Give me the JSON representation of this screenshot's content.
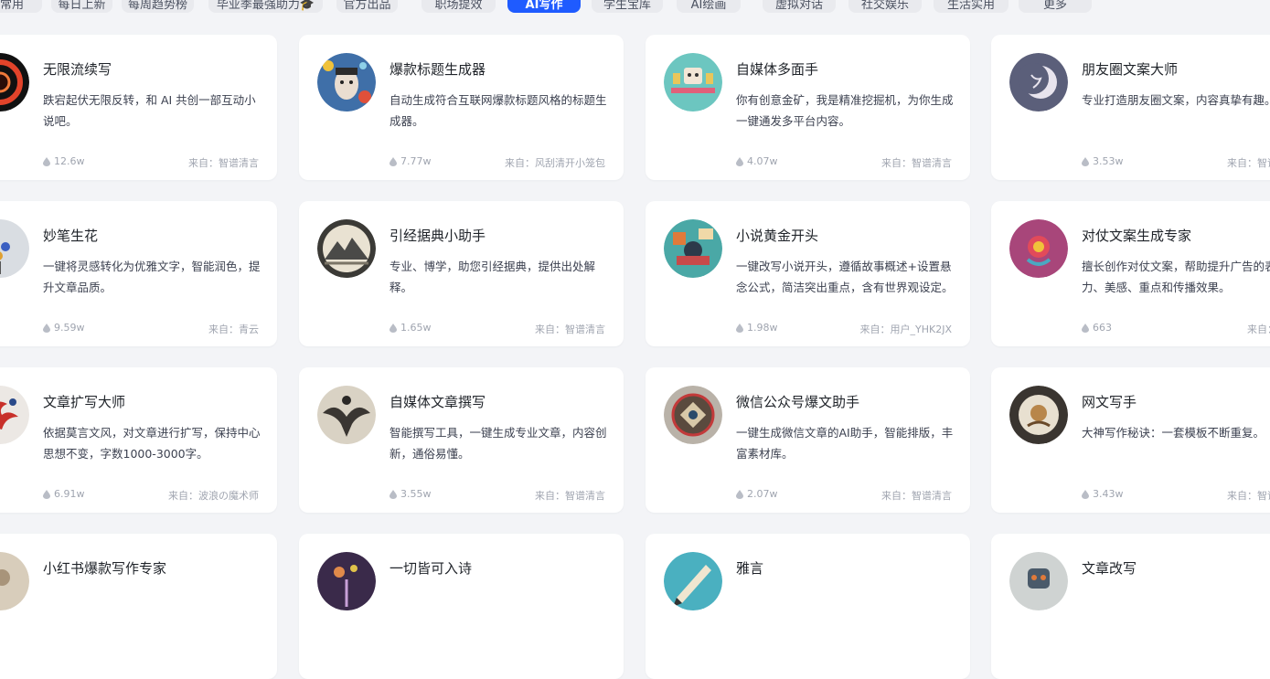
{
  "tabs": [
    {
      "label": "常用"
    },
    {
      "label": "每日上新"
    },
    {
      "label": "每周趋势榜"
    },
    {
      "label": "毕业季最强助力🎓"
    },
    {
      "label": "官方出品"
    },
    {
      "label": "职场提效"
    },
    {
      "label": "AI写作"
    },
    {
      "label": "学生宝库"
    },
    {
      "label": "AI绘画"
    },
    {
      "label": "虚拟对话"
    },
    {
      "label": "社交娱乐"
    },
    {
      "label": "生活实用"
    },
    {
      "label": "更多"
    }
  ],
  "active_tab": "AI写作",
  "cards": [
    {
      "title": "无限流续写",
      "desc": "跌宕起伏无限反转，和 AI 共创一部互动小说吧。",
      "views": "12.6w",
      "source": "来自：智谱清言",
      "avatar": "vortex-avatar"
    },
    {
      "title": "爆款标题生成器",
      "desc": "自动生成符合互联网爆款标题风格的标题生成器。",
      "views": "7.77w",
      "source": "来自：风刮清开小笼包",
      "avatar": "pop-art-face-avatar"
    },
    {
      "title": "自媒体多面手",
      "desc": "你有创意金矿，我是精准挖掘机，为你生成一键通发多平台内容。",
      "views": "4.07w",
      "source": "来自：智谱清言",
      "avatar": "robot-desk-avatar"
    },
    {
      "title": "朋友圈文案大师",
      "desc": "专业打造朋友圈文案，内容真挚有趣。",
      "views": "3.53w",
      "source": "来自：智谱清言",
      "avatar": "moon-avatar"
    },
    {
      "title": "妙笔生花",
      "desc": "一键将灵感转化为优雅文字，智能润色，提升文章品质。",
      "views": "9.59w",
      "source": "来自：青云",
      "avatar": "flower-sketch-avatar"
    },
    {
      "title": "引经据典小助手",
      "desc": "专业、博学，助您引经据典，提供出处解释。",
      "views": "1.65w",
      "source": "来自：智谱清言",
      "avatar": "ink-mountain-avatar"
    },
    {
      "title": "小说黄金开头",
      "desc": "一键改写小说开头，遵循故事概述+设置悬念公式，简洁突出重点，含有世界观设定。",
      "views": "1.98w",
      "source": "来自：用户_YHK2JX",
      "avatar": "collage-avatar"
    },
    {
      "title": "对仗文案生成专家",
      "desc": "擅长创作对仗文案，帮助提升广告的表现力、美感、重点和传播效果。",
      "views": "663",
      "source": "来自：柳叶",
      "avatar": "ornament-avatar"
    },
    {
      "title": "文章扩写大师",
      "desc": "依据莫言文风，对文章进行扩写，保持中心思想不变，字数1000-3000字。",
      "views": "6.91w",
      "source": "来自：波浪の魔术师",
      "avatar": "red-dragon-avatar"
    },
    {
      "title": "自媒体文章撰写",
      "desc": "智能撰写工具，一键生成专业文章，内容创新，通俗易懂。",
      "views": "3.55w",
      "source": "来自：智谱清言",
      "avatar": "eagle-avatar"
    },
    {
      "title": "微信公众号爆文助手",
      "desc": "一键生成微信文章的AI助手，智能排版，丰富素材库。",
      "views": "2.07w",
      "source": "来自：智谱清言",
      "avatar": "medallion-avatar"
    },
    {
      "title": "网文写手",
      "desc": "大神写作秘诀：一套模板不断重复。",
      "views": "3.43w",
      "source": "来自：智谱清言",
      "avatar": "emblem-avatar"
    },
    {
      "title": "小红书爆款写作专家",
      "desc": "",
      "views": "",
      "source": "",
      "avatar": "beige-avatar"
    },
    {
      "title": "一切皆可入诗",
      "desc": "",
      "views": "",
      "source": "",
      "avatar": "fireworks-avatar"
    },
    {
      "title": "雅言",
      "desc": "",
      "views": "",
      "source": "",
      "avatar": "pen-avatar"
    },
    {
      "title": "文章改写",
      "desc": "",
      "views": "",
      "source": "",
      "avatar": "robot-head-avatar"
    }
  ],
  "colors": {
    "accent": "#1f5bff",
    "page_bg": "#f3f4f7",
    "card_bg": "#ffffff"
  }
}
